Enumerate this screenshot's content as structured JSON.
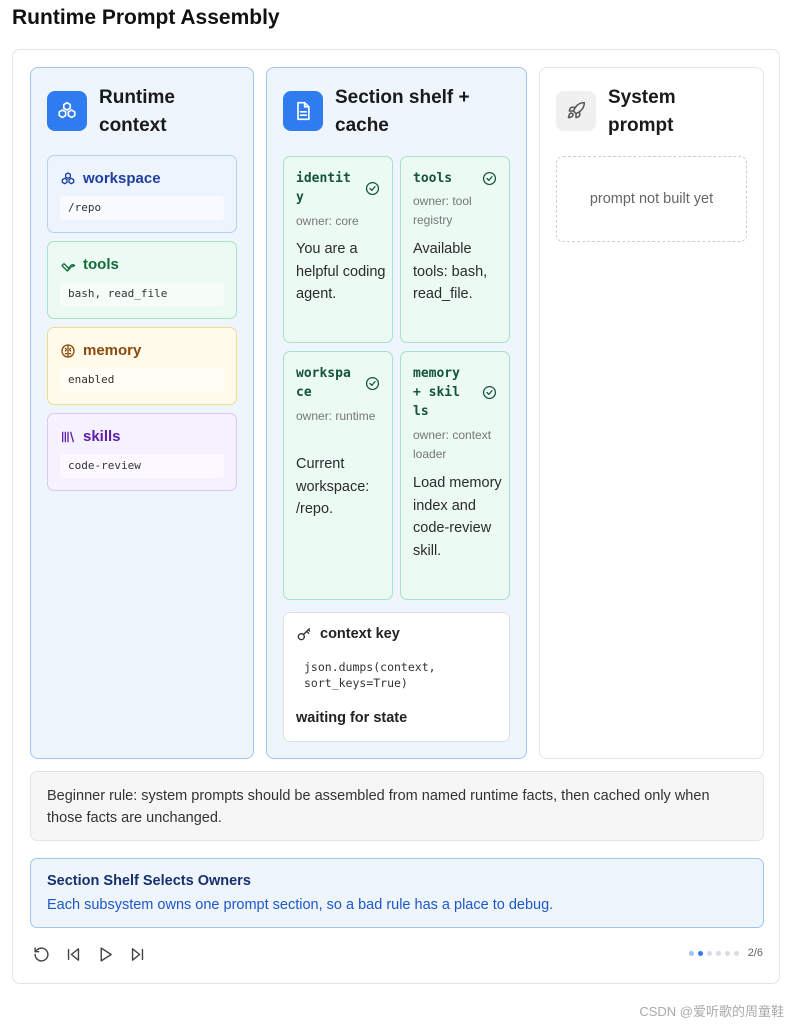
{
  "title": "Runtime Prompt Assembly",
  "runtime": {
    "title": "Runtime context",
    "cards": [
      {
        "label": "workspace",
        "value": "/repo",
        "icon": "hexagon-cluster-icon"
      },
      {
        "label": "tools",
        "value": "bash, read_file",
        "icon": "wrench-icon"
      },
      {
        "label": "memory",
        "value": "enabled",
        "icon": "brain-icon"
      },
      {
        "label": "skills",
        "value": "code-review",
        "icon": "library-icon"
      }
    ]
  },
  "shelf": {
    "title": "Section shelf + cache",
    "sections": [
      {
        "name": "identity",
        "owner": "owner: core",
        "body": "You are a helpful coding agent."
      },
      {
        "name": "tools",
        "owner": "owner: tool registry",
        "body": "Available tools: bash, read_file."
      },
      {
        "name": "workspace",
        "owner": "owner: runtime",
        "body": "Current workspace: /repo."
      },
      {
        "name": "memory + skills",
        "owner": "owner: context loader",
        "body": "Load memory index and code-review skill."
      }
    ],
    "key_card": {
      "title": "context key",
      "code": "json.dumps(context,\nsort_keys=True)",
      "status": "waiting for state"
    }
  },
  "system": {
    "title": "System prompt",
    "empty_text": "prompt not built yet",
    "icon": "rocket-icon"
  },
  "rule_text": "Beginner rule: system prompts should be assembled from named runtime facts, then cached only when those facts are unchanged.",
  "step": {
    "title": "Section Shelf Selects Owners",
    "description": "Each subsystem owns one prompt section, so a bad rule has a place to debug."
  },
  "controls": [
    "restart-icon",
    "skip-back-icon",
    "play-icon",
    "skip-forward-icon"
  ],
  "pager": {
    "current": 2,
    "total": 6,
    "text": "2/6"
  },
  "watermark": "CSDN @爱听歌的周童鞋",
  "colors": {
    "accent": "#2f7cf0",
    "section_bg": "#ebfaf3",
    "section_border": "#a6e2c3"
  }
}
